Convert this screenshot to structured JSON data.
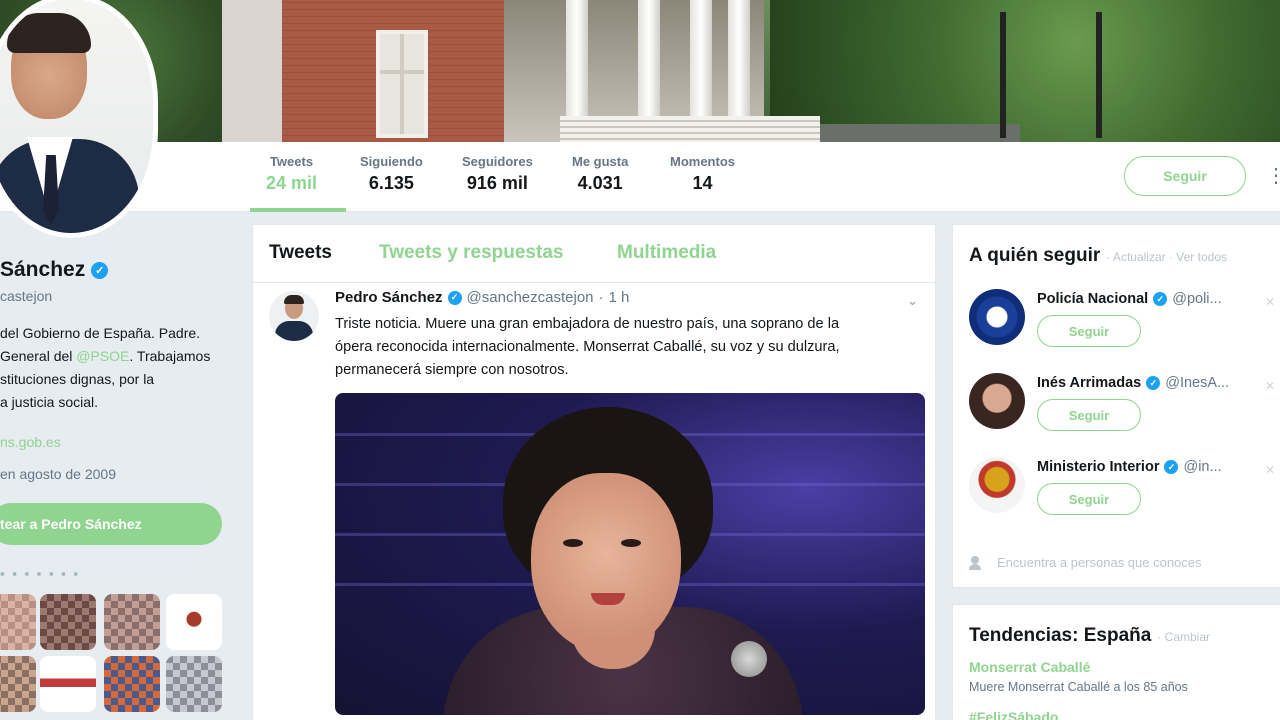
{
  "profile": {
    "name": "Sánchez",
    "handle": "castejon",
    "bio": {
      "line1": "del Gobierno de España. Padre.",
      "line2_pre": "General del ",
      "line2_link": "@PSOE",
      "line2_post": ". Trabajamos",
      "line3": "stituciones dignas, por la",
      "line4": "a justicia social."
    },
    "url": "ns.gob.es",
    "joined": "en agosto de 2009",
    "tweet_to_label": "tear a Pedro Sánchez",
    "followers_you_know": "▪ ▪ ▪ ▪ ▪ ▪ ▪"
  },
  "nav": {
    "stats": [
      {
        "label": "Tweets",
        "value": "24 mil"
      },
      {
        "label": "Siguiendo",
        "value": "6.135"
      },
      {
        "label": "Seguidores",
        "value": "916 mil"
      },
      {
        "label": "Me gusta",
        "value": "4.031"
      },
      {
        "label": "Momentos",
        "value": "14"
      }
    ],
    "follow_label": "Seguir",
    "more_icon": "more-vertical-icon"
  },
  "timeline": {
    "tabs": [
      "Tweets",
      "Tweets y respuestas",
      "Multimedia"
    ],
    "tweet": {
      "author": "Pedro Sánchez",
      "handle": "@sanchezcastejon",
      "separator": "·",
      "time": "1 h",
      "text_line1": "Triste noticia. Muere una gran embajadora de nuestro país, una soprano de la",
      "text_line2": "ópera reconocida internacionalmente. Monserrat Caballé, su voz y su dulzura,",
      "text_line3": "permanecerá siempre con nosotros."
    }
  },
  "who_to_follow": {
    "title": "A quién seguir",
    "sub": "· Actualizar · Ver todos",
    "suggestions": [
      {
        "name": "Policía Nacional",
        "handle": "@poli...",
        "follow": "Seguir"
      },
      {
        "name": "Inés Arrimadas",
        "handle": "@InesA...",
        "follow": "Seguir"
      },
      {
        "name": "Ministerio Interior",
        "handle": "@in...",
        "follow": "Seguir"
      }
    ],
    "find_people": "Encuentra a personas que conoces"
  },
  "trends": {
    "title": "Tendencias: España",
    "sub": "· Cambiar",
    "items": [
      {
        "name": "Monserrat Caballé",
        "desc": "Muere Monserrat Caballé a los 85 años"
      },
      {
        "name": "#FelizSábado",
        "desc": ""
      }
    ]
  },
  "colors": {
    "accent": "#8fd48f",
    "verified": "#1da1f2",
    "text": "#14171a",
    "muted": "#657786",
    "background": "#e6ecf0"
  }
}
